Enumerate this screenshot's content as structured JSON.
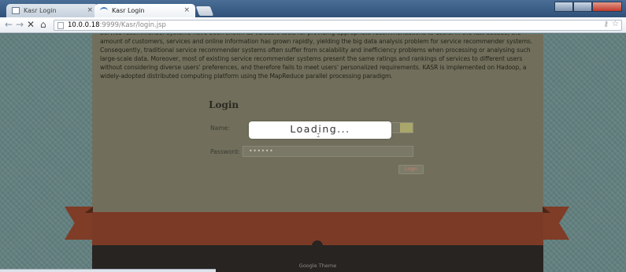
{
  "browser": {
    "tabs": [
      {
        "label": "Kasr Login",
        "active": false
      },
      {
        "label": "Kasr Login",
        "active": true
      }
    ],
    "tab_close_glyph": "×",
    "url_host": "10.0.0.18",
    "url_rest": ":9999/Kasr/login.jsp",
    "nav_icons": [
      "back-arrow-icon",
      "forward-arrow-icon",
      "stop-icon",
      "home-icon"
    ]
  },
  "page": {
    "abstract": "Service recommender systems have been shown as valuable tools for providing appropriate recommendations to users. In the last decade, the amount of customers, services and online information has grown rapidly, yielding the big data analysis problem for service recommender systems. Consequently, traditional service recommender systems often suffer from scalability and inefficiency problems when processing or analysing such large-scale data. Moreover, most of existing service recommender systems present the same ratings and rankings of services to different users without considering diverse users' preferences, and therefore fails to meet users' personalized requirements. KASR is implemented on Hadoop, a widely-adopted distributed computing platform using the MapReduce parallel processing paradigm.",
    "login": {
      "title": "Login",
      "name_label": "Name:",
      "name_value": "",
      "password_label": "Password:",
      "password_value": "••••••",
      "submit_label": "Login"
    },
    "footer_text": "Google Theme"
  },
  "overlay": {
    "loading_text": "Loading..."
  },
  "colors": {
    "content_bg": "#716f5c",
    "ribbon": "#7b3a25",
    "footer": "#272422",
    "page_bg": "#627f7e"
  }
}
